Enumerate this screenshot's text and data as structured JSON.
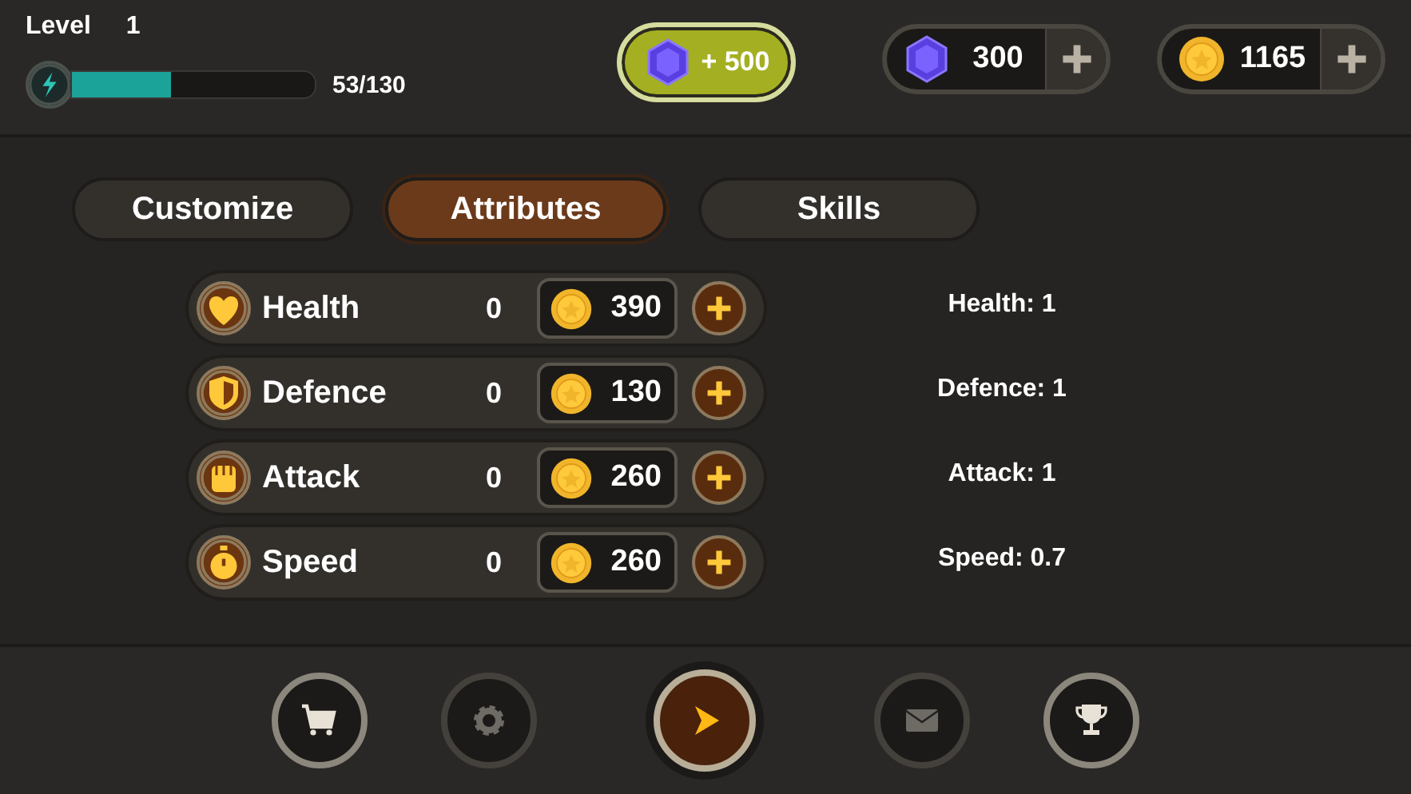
{
  "player": {
    "level_label": "Level",
    "level": "1",
    "xp": {
      "level": 0.41,
      "reading": "53/130"
    }
  },
  "gem_offer": {
    "label": "+ 500"
  },
  "currencies": [
    {
      "kind": "gem",
      "amount": "300"
    },
    {
      "kind": "coin",
      "amount": "1165"
    }
  ],
  "tabs": [
    {
      "label": "Customize",
      "selected": false
    },
    {
      "label": "Attributes",
      "selected": true
    },
    {
      "label": "Skills",
      "selected": false
    }
  ],
  "attributes": [
    {
      "kind": "health",
      "name": "Health",
      "points": "0",
      "cost": "390"
    },
    {
      "kind": "defence",
      "name": "Defence",
      "points": "0",
      "cost": "130"
    },
    {
      "kind": "attack",
      "name": "Attack",
      "points": "0",
      "cost": "260"
    },
    {
      "kind": "speed",
      "name": "Speed",
      "points": "0",
      "cost": "260"
    }
  ],
  "stats": [
    "Health: 1",
    "Defence: 1",
    "Attack: 1",
    "Speed: 0.7"
  ],
  "bottom_nav": [
    {
      "kind": "shop",
      "disabled": false
    },
    {
      "kind": "settings",
      "disabled": true
    },
    {
      "kind": "play",
      "disabled": false
    },
    {
      "kind": "mail",
      "disabled": true
    },
    {
      "kind": "trophy",
      "disabled": false
    }
  ]
}
